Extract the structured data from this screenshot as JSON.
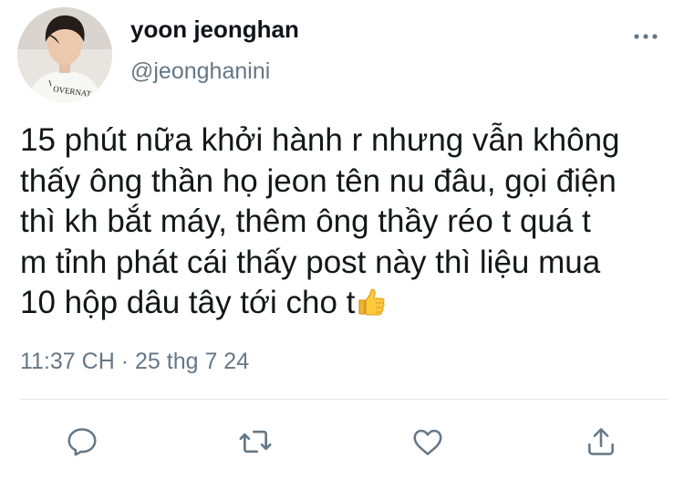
{
  "tweet": {
    "author_name": "yoon jeonghan",
    "author_handle": "@jeonghanini",
    "text_lines": [
      "15 phút nữa khởi hành r nhưng vẫn không",
      "thấy ông thần họ jeon tên nu đâu, gọi điện",
      "thì kh bắt máy, thêm ông thầy réo t quá t",
      "m tỉnh phát cái thấy post này thì liệu mua",
      "10 hộp dâu tây tới cho t"
    ],
    "emoji": "thumbs-up-emoji",
    "avatar_shirt_text": "OVERNAT",
    "timestamp": "11:37 CH",
    "separator": "·",
    "date": "25 thg 7 24"
  },
  "icons": {
    "more": "more-horizontal-icon",
    "reply": "reply-icon",
    "retweet": "retweet-icon",
    "like": "heart-icon",
    "share": "share-icon"
  },
  "colors": {
    "text": "#14171a",
    "secondary": "#657786",
    "divider": "#e1e8ed"
  }
}
